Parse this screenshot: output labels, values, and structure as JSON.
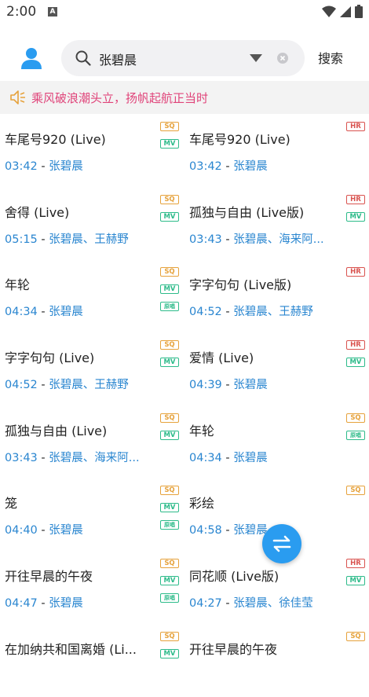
{
  "status": {
    "time": "2:00",
    "notif": "A"
  },
  "search": {
    "value": "张碧晨",
    "button": "搜索"
  },
  "banner": {
    "text": "乘风破浪潮头立，扬帆起航正当时"
  },
  "colors": {
    "accent": "#2a86d0",
    "banner_text": "#e0447a",
    "fab": "#2a9cf0"
  },
  "rows": [
    {
      "left": {
        "title": "车尾号920 (Live)",
        "duration": "03:42",
        "artists": "张碧晨",
        "badges": [
          "SQ",
          "MV"
        ]
      },
      "right": {
        "title": "车尾号920 (Live)",
        "duration": "03:42",
        "artists": "张碧晨",
        "badges": [
          "HR"
        ]
      }
    },
    {
      "left": {
        "title": "舍得 (Live)",
        "duration": "05:15",
        "artists": "张碧晨、王赫野",
        "badges": [
          "SQ",
          "MV"
        ]
      },
      "right": {
        "title": "孤独与自由 (Live版)",
        "duration": "03:43",
        "artists": "张碧晨、海来阿...",
        "badges": [
          "HR",
          "MV"
        ]
      }
    },
    {
      "left": {
        "title": "年轮",
        "duration": "04:34",
        "artists": "张碧晨",
        "badges": [
          "SQ",
          "MV",
          "原唱"
        ]
      },
      "right": {
        "title": "字字句句 (Live版)",
        "duration": "04:52",
        "artists": "张碧晨、王赫野",
        "badges": [
          "HR"
        ]
      }
    },
    {
      "left": {
        "title": "字字句句 (Live)",
        "duration": "04:52",
        "artists": "张碧晨、王赫野",
        "badges": [
          "SQ",
          "MV"
        ]
      },
      "right": {
        "title": "爱情 (Live)",
        "duration": "04:39",
        "artists": "张碧晨",
        "badges": [
          "HR",
          "MV"
        ]
      }
    },
    {
      "left": {
        "title": "孤独与自由 (Live)",
        "duration": "03:43",
        "artists": "张碧晨、海来阿...",
        "badges": [
          "SQ",
          "MV"
        ]
      },
      "right": {
        "title": "年轮",
        "duration": "04:34",
        "artists": "张碧晨",
        "badges": [
          "SQ",
          "原唱"
        ]
      }
    },
    {
      "left": {
        "title": "笼",
        "duration": "04:40",
        "artists": "张碧晨",
        "badges": [
          "SQ",
          "MV",
          "原唱"
        ]
      },
      "right": {
        "title": "彩绘",
        "duration": "04:58",
        "artists": "张碧晨",
        "badges": [
          "SQ"
        ]
      }
    },
    {
      "left": {
        "title": "开往早晨的午夜",
        "duration": "04:47",
        "artists": "张碧晨",
        "badges": [
          "SQ",
          "MV",
          "原唱"
        ]
      },
      "right": {
        "title": "同花顺 (Live版)",
        "duration": "04:27",
        "artists": "张碧晨、徐佳莹",
        "badges": [
          "HR",
          "MV"
        ]
      }
    },
    {
      "left": {
        "title": "在加纳共和国离婚 (Li...",
        "duration": "",
        "artists": "",
        "badges": [
          "SQ",
          "MV"
        ]
      },
      "right": {
        "title": "开往早晨的午夜",
        "duration": "",
        "artists": "",
        "badges": [
          "SQ"
        ]
      }
    }
  ]
}
